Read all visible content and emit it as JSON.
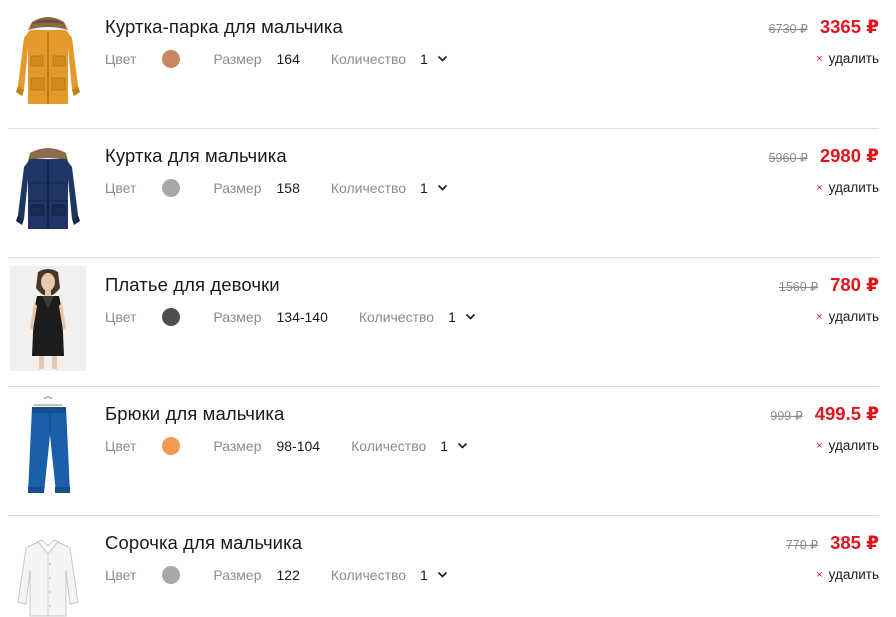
{
  "labels": {
    "color": "Цвет",
    "size": "Размер",
    "quantity": "Количество",
    "remove": "удалить",
    "remove_icon": "×"
  },
  "items": [
    {
      "title": "Куртка-парка для мальчика",
      "color_hex": "#c98662",
      "size": "164",
      "quantity": "1",
      "old_price": "6730 ₽",
      "price": "3365 ₽",
      "image": "orange-parka-icon"
    },
    {
      "title": "Куртка для мальчика",
      "color_hex": "#a8a8a8",
      "size": "158",
      "quantity": "1",
      "old_price": "5960 ₽",
      "price": "2980 ₽",
      "image": "navy-jacket-icon"
    },
    {
      "title": "Платье для девочки",
      "color_hex": "#4f4f4f",
      "size": "134-140",
      "quantity": "1",
      "old_price": "1560 ₽",
      "price": "780 ₽",
      "image": "black-dress-photo"
    },
    {
      "title": "Брюки для мальчика",
      "color_hex": "#f29a52",
      "size": "98-104",
      "quantity": "1",
      "old_price": "999 ₽",
      "price": "499.5 ₽",
      "image": "blue-trousers-icon"
    },
    {
      "title": "Сорочка для мальчика",
      "color_hex": "#a8a8a8",
      "size": "122",
      "quantity": "1",
      "old_price": "770 ₽",
      "price": "385 ₽",
      "image": "white-shirt-icon"
    }
  ]
}
